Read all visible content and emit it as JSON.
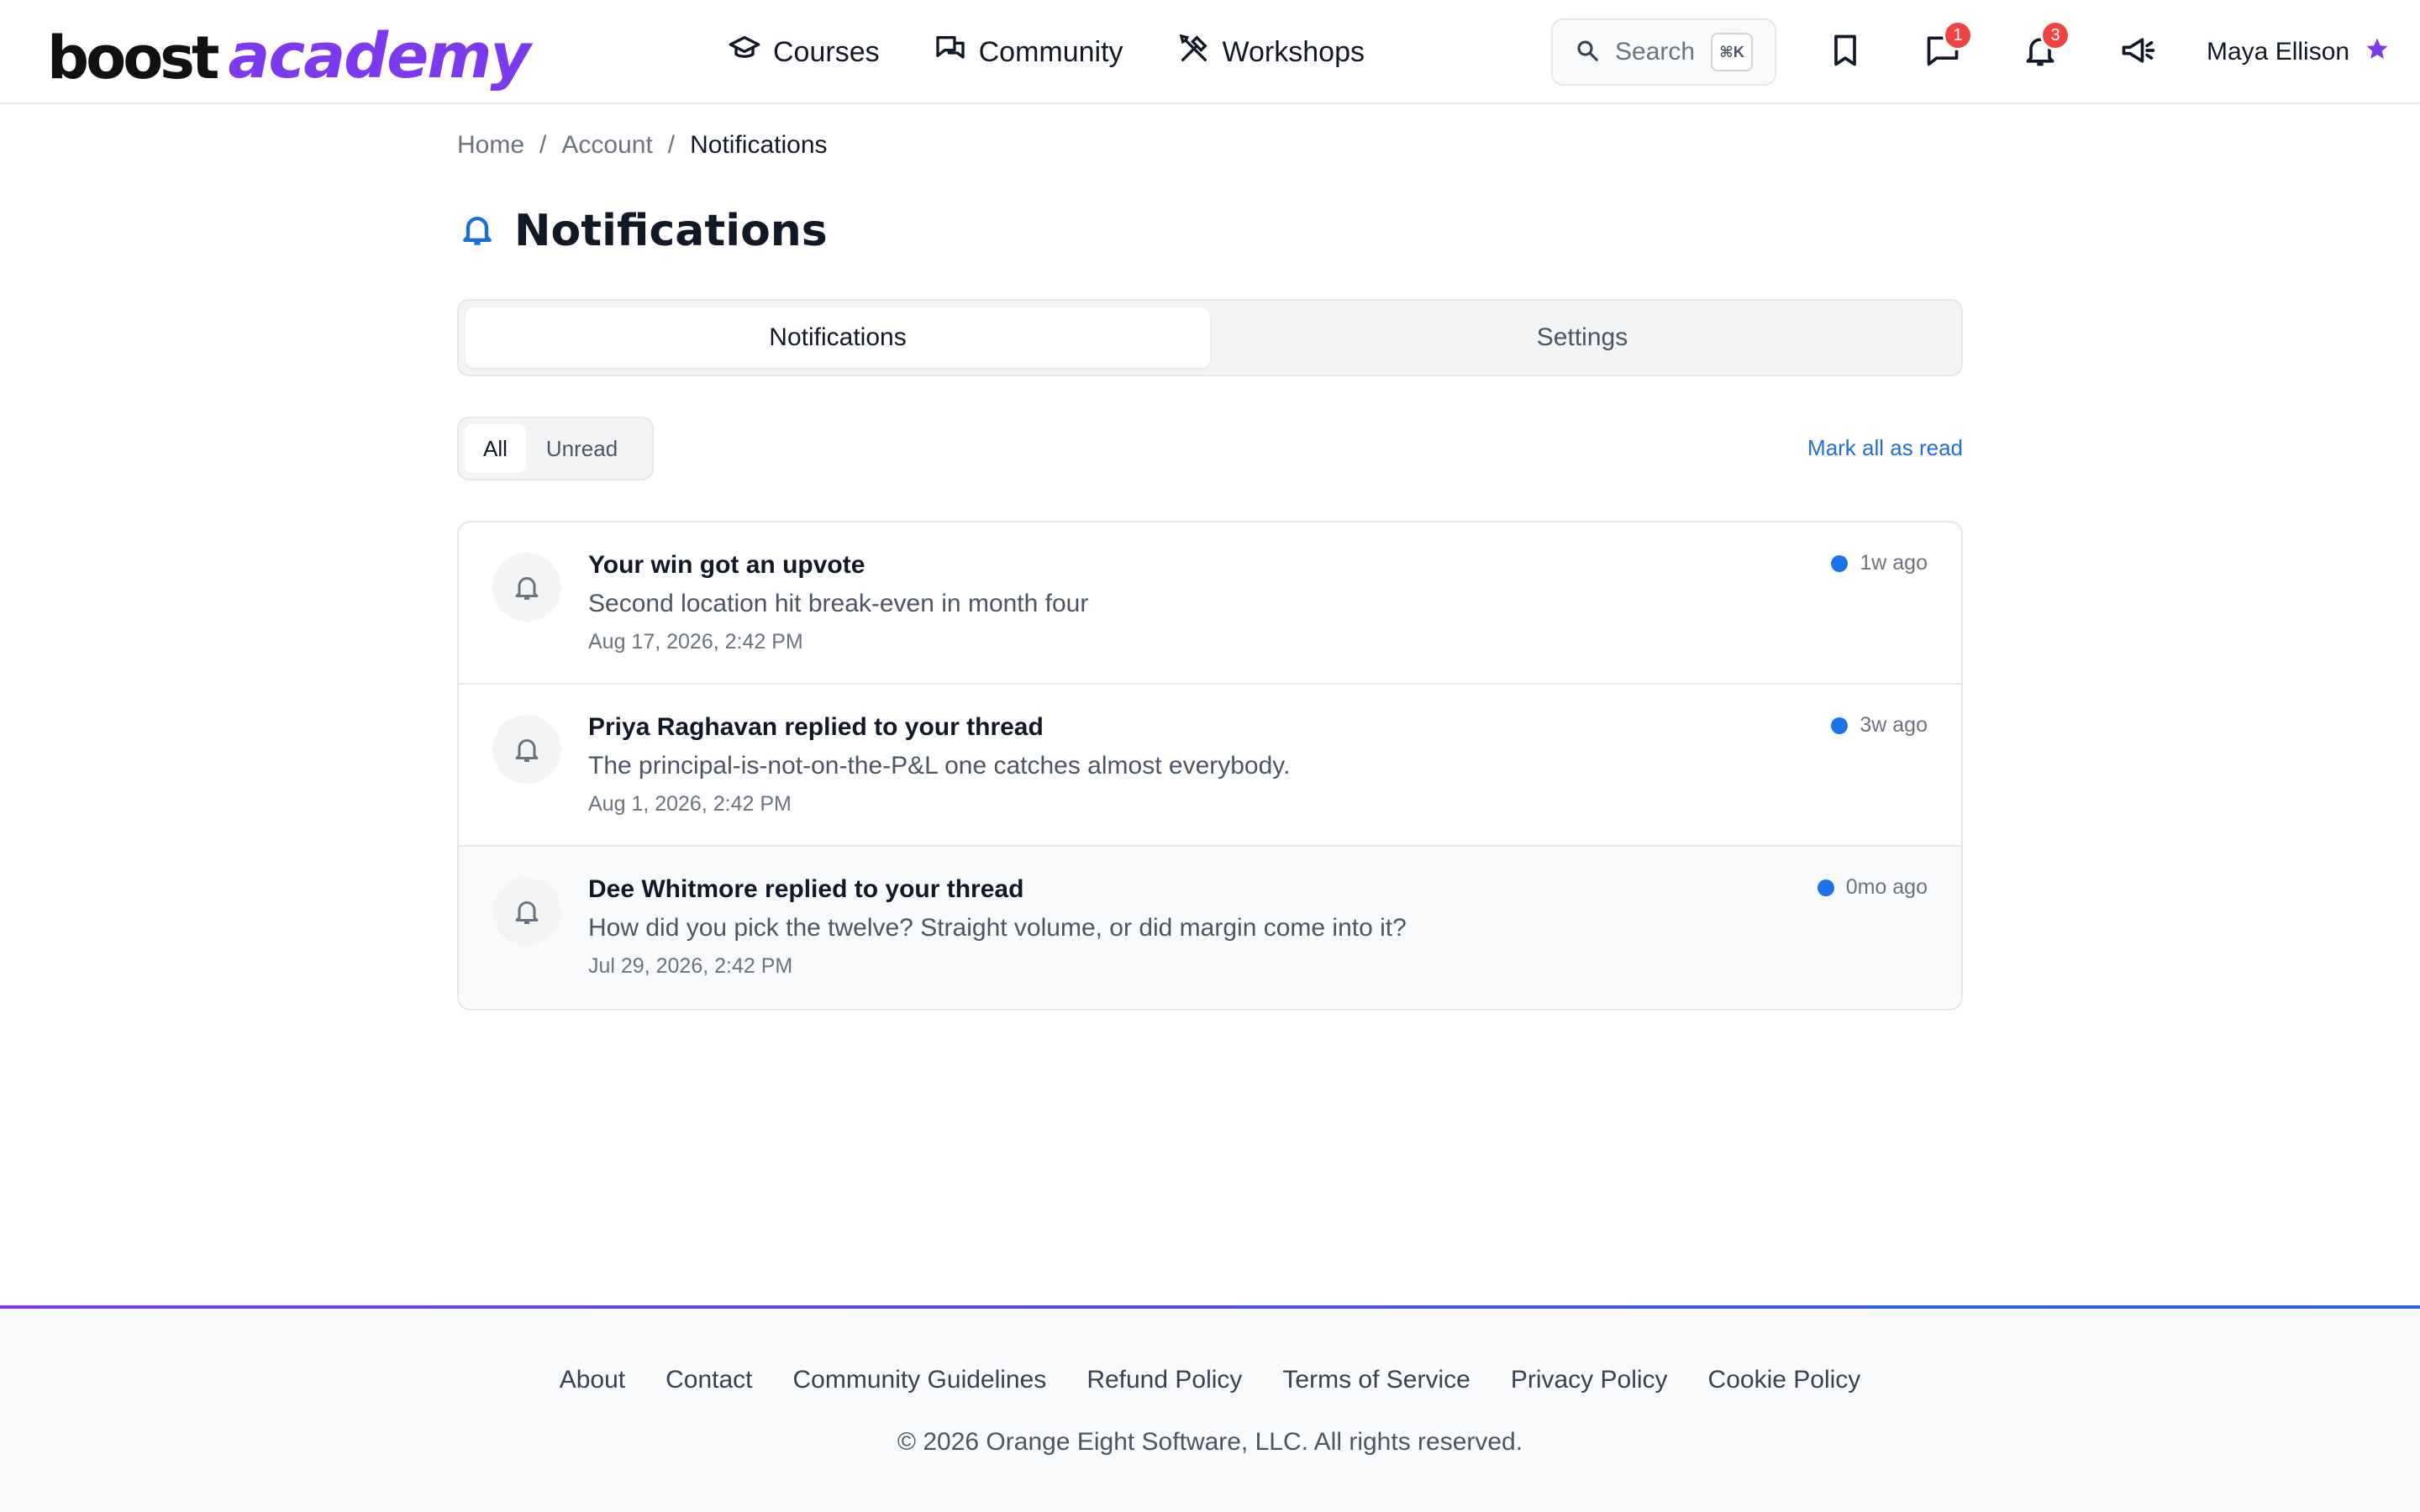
{
  "header": {
    "logo": {
      "part1": "boost",
      "part2": "academy"
    },
    "nav": [
      {
        "label": "Courses",
        "icon": "graduation-cap-icon"
      },
      {
        "label": "Community",
        "icon": "chat-bubbles-icon"
      },
      {
        "label": "Workshops",
        "icon": "tools-icon"
      }
    ],
    "search": {
      "placeholder": "Search",
      "shortcut": "⌘K"
    },
    "icons": {
      "bookmark": "bookmark-icon",
      "messages": {
        "icon": "message-icon",
        "badge": "1"
      },
      "notifications": {
        "icon": "bell-icon",
        "badge": "3"
      },
      "announcements": "megaphone-icon"
    },
    "user": {
      "name": "Maya Ellison",
      "icon": "star-icon"
    }
  },
  "breadcrumb": {
    "home": "Home",
    "account": "Account",
    "current": "Notifications",
    "separator": "/"
  },
  "page": {
    "title": "Notifications"
  },
  "tabs": [
    {
      "label": "Notifications",
      "active": true
    },
    {
      "label": "Settings",
      "active": false
    }
  ],
  "filters": {
    "all": "All",
    "unread": "Unread",
    "mark_all": "Mark all as read"
  },
  "notifications": [
    {
      "title": "Your win got an upvote",
      "body": "Second location hit break-even in month four",
      "date": "Aug 17, 2026, 2:42 PM",
      "relative": "1w ago"
    },
    {
      "title": "Priya Raghavan replied to your thread",
      "body": "The principal-is-not-on-the-P&L one catches almost everybody.",
      "date": "Aug 1, 2026, 2:42 PM",
      "relative": "3w ago"
    },
    {
      "title": "Dee Whitmore replied to your thread",
      "body": "How did you pick the twelve? Straight volume, or did margin come into it?",
      "date": "Jul 29, 2026, 2:42 PM",
      "relative": "0mo ago"
    }
  ],
  "footer": {
    "links": [
      "About",
      "Contact",
      "Community Guidelines",
      "Refund Policy",
      "Terms of Service",
      "Privacy Policy",
      "Cookie Policy"
    ],
    "copyright": "© 2026 Orange Eight Software, LLC. All rights reserved."
  },
  "colors": {
    "brand": "#7c3aed",
    "accent_blue": "#1d72e8",
    "badge": "#ef4444"
  }
}
